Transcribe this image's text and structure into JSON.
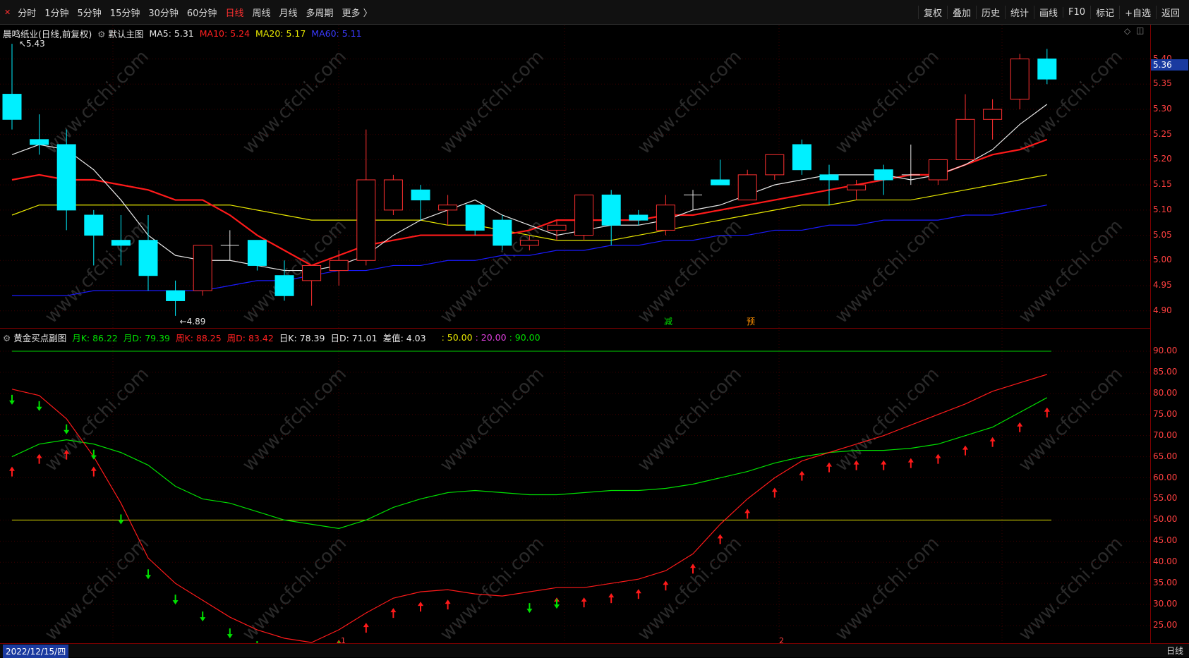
{
  "toolbar": {
    "left_items": [
      "分时",
      "1分钟",
      "5分钟",
      "15分钟",
      "30分钟",
      "60分钟",
      "日线",
      "周线",
      "月线",
      "多周期",
      "更多 〉"
    ],
    "active": "日线",
    "right_items": [
      "复权",
      "叠加",
      "历史",
      "统计",
      "画线",
      "F10",
      "标记",
      "+自选",
      "返回"
    ]
  },
  "main_info": {
    "stock": "晨鸣纸业(日线,前复权)",
    "indicator": "默认主图",
    "ma5": "MA5: 5.31",
    "ma10": "MA10: 5.24",
    "ma20": "MA20: 5.17",
    "ma60": "MA60: 5.11"
  },
  "sub_info": {
    "indicator": "黄金买点副图",
    "yk": "月K: 86.22",
    "yd": "月D: 79.39",
    "zk": "周K: 88.25",
    "zd": "周D: 83.42",
    "rk": "日K: 78.39",
    "rd": "日D: 71.01",
    "diff": "差值: 4.03",
    "l50": ": 50.00",
    "l20": ": 20.00",
    "l90": ": 90.00"
  },
  "main_axis": [
    "5.40",
    "5.35",
    "5.30",
    "5.25",
    "5.20",
    "5.15",
    "5.10",
    "5.05",
    "5.00",
    "4.95",
    "4.90"
  ],
  "sub_axis": [
    "90.00",
    "85.00",
    "80.00",
    "75.00",
    "70.00",
    "65.00",
    "60.00",
    "55.00",
    "50.00",
    "45.00",
    "40.00",
    "35.00",
    "30.00",
    "25.00"
  ],
  "current_price": "5.36",
  "high_label": "5.43",
  "low_label": "4.89",
  "markers": {
    "jian": "减",
    "yu": "预"
  },
  "bottom": {
    "date": "2022/12/15/四",
    "period": "日线",
    "m1": "1",
    "m2": "2"
  },
  "watermark": "www.cfchi.com",
  "colors": {
    "up": "#ff3030",
    "down": "#00f0ff",
    "ma5": "#e8e8e8",
    "ma10": "#ff1a1a",
    "ma20": "#e8e800",
    "ma60": "#1a1aff"
  },
  "chart_data": [
    {
      "type": "candlestick",
      "ylim": [
        4.88,
        5.44
      ],
      "candles": [
        [
          5.33,
          5.28,
          5.43,
          5.26
        ],
        [
          5.24,
          5.23,
          5.29,
          5.21
        ],
        [
          5.23,
          5.1,
          5.26,
          5.06
        ],
        [
          5.09,
          5.05,
          5.1,
          4.99
        ],
        [
          5.04,
          5.03,
          5.09,
          4.99
        ],
        [
          5.04,
          4.97,
          5.09,
          4.94
        ],
        [
          4.94,
          4.92,
          4.96,
          4.89
        ],
        [
          4.94,
          5.03,
          5.03,
          4.93
        ],
        [
          5.03,
          5.03,
          5.06,
          5.0
        ],
        [
          5.04,
          4.99,
          5.04,
          4.98
        ],
        [
          4.97,
          4.93,
          5.0,
          4.92
        ],
        [
          4.96,
          4.99,
          4.99,
          4.91
        ],
        [
          4.98,
          5.0,
          5.02,
          4.95
        ],
        [
          5.0,
          5.16,
          5.26,
          4.99
        ],
        [
          5.1,
          5.16,
          5.17,
          5.09
        ],
        [
          5.14,
          5.12,
          5.15,
          5.08
        ],
        [
          5.1,
          5.11,
          5.13,
          5.07
        ],
        [
          5.11,
          5.06,
          5.11,
          5.05
        ],
        [
          5.08,
          5.03,
          5.09,
          5.02
        ],
        [
          5.03,
          5.04,
          5.05,
          5.02
        ],
        [
          5.06,
          5.07,
          5.08,
          5.04
        ],
        [
          5.05,
          5.13,
          5.13,
          5.04
        ],
        [
          5.13,
          5.07,
          5.14,
          5.03
        ],
        [
          5.09,
          5.08,
          5.1,
          5.07
        ],
        [
          5.06,
          5.11,
          5.13,
          5.05
        ],
        [
          5.13,
          5.13,
          5.14,
          5.1
        ],
        [
          5.16,
          5.15,
          5.2,
          5.15
        ],
        [
          5.12,
          5.17,
          5.18,
          5.12
        ],
        [
          5.17,
          5.21,
          5.21,
          5.16
        ],
        [
          5.23,
          5.18,
          5.24,
          5.17
        ],
        [
          5.17,
          5.16,
          5.19,
          5.11
        ],
        [
          5.14,
          5.15,
          5.16,
          5.12
        ],
        [
          5.18,
          5.16,
          5.19,
          5.13
        ],
        [
          5.17,
          5.17,
          5.23,
          5.15
        ],
        [
          5.16,
          5.2,
          5.2,
          5.15
        ],
        [
          5.2,
          5.28,
          5.33,
          5.2
        ],
        [
          5.28,
          5.3,
          5.32,
          5.24
        ],
        [
          5.32,
          5.4,
          5.41,
          5.3
        ],
        [
          5.4,
          5.36,
          5.42,
          5.35
        ]
      ],
      "ma5": [
        5.21,
        5.23,
        5.22,
        5.18,
        5.12,
        5.05,
        5.01,
        5.0,
        5.0,
        4.99,
        4.98,
        4.98,
        4.99,
        5.01,
        5.05,
        5.08,
        5.1,
        5.12,
        5.09,
        5.07,
        5.05,
        5.06,
        5.07,
        5.07,
        5.08,
        5.1,
        5.11,
        5.13,
        5.15,
        5.16,
        5.17,
        5.17,
        5.17,
        5.16,
        5.17,
        5.19,
        5.22,
        5.27,
        5.31
      ],
      "ma10": [
        5.16,
        5.17,
        5.16,
        5.16,
        5.15,
        5.14,
        5.12,
        5.12,
        5.09,
        5.05,
        5.02,
        4.99,
        5.01,
        5.03,
        5.04,
        5.05,
        5.05,
        5.05,
        5.05,
        5.06,
        5.08,
        5.08,
        5.08,
        5.08,
        5.09,
        5.09,
        5.1,
        5.11,
        5.12,
        5.13,
        5.14,
        5.15,
        5.16,
        5.17,
        5.17,
        5.19,
        5.21,
        5.22,
        5.24
      ],
      "ma20": [
        5.09,
        5.11,
        5.11,
        5.11,
        5.11,
        5.11,
        5.11,
        5.11,
        5.11,
        5.1,
        5.09,
        5.08,
        5.08,
        5.08,
        5.08,
        5.08,
        5.07,
        5.07,
        5.06,
        5.05,
        5.04,
        5.04,
        5.04,
        5.05,
        5.06,
        5.07,
        5.08,
        5.09,
        5.1,
        5.11,
        5.11,
        5.12,
        5.12,
        5.12,
        5.13,
        5.14,
        5.15,
        5.16,
        5.17
      ],
      "ma60": [
        4.93,
        4.93,
        4.93,
        4.94,
        4.94,
        4.94,
        4.94,
        4.94,
        4.95,
        4.96,
        4.96,
        4.97,
        4.98,
        4.98,
        4.99,
        4.99,
        5.0,
        5.0,
        5.01,
        5.01,
        5.02,
        5.02,
        5.03,
        5.03,
        5.04,
        5.04,
        5.05,
        5.05,
        5.06,
        5.06,
        5.07,
        5.07,
        5.08,
        5.08,
        5.08,
        5.09,
        5.09,
        5.1,
        5.11
      ]
    },
    {
      "type": "line",
      "ylim": [
        22,
        93
      ],
      "levels": [
        90,
        50,
        20
      ],
      "series": [
        {
          "name": "月K",
          "values": [
            65,
            68,
            69,
            68,
            66,
            63,
            58,
            55,
            54,
            52,
            50,
            49,
            48,
            50,
            53,
            55,
            56.5,
            57,
            56.5,
            56,
            56,
            56.5,
            57,
            57,
            57.5,
            58.5,
            60,
            61.5,
            63.5,
            65,
            66,
            66.5,
            66.5,
            67,
            68,
            70,
            72,
            75.5,
            79
          ]
        },
        {
          "name": "月D",
          "values": [
            81,
            79.5,
            74,
            65,
            54,
            41,
            35,
            31,
            27,
            24,
            22,
            21,
            24,
            28,
            31.5,
            33,
            33.5,
            32.5,
            32,
            33,
            34,
            34,
            35,
            36,
            38,
            42,
            49,
            55,
            60,
            64,
            66,
            68,
            70,
            72.5,
            75,
            77.5,
            80.5,
            82.5,
            84.5
          ]
        }
      ],
      "arrows_up": [
        0,
        1,
        2,
        3,
        12,
        13,
        14,
        15,
        16,
        20,
        21,
        22,
        23,
        24,
        25,
        26,
        27,
        28,
        29,
        30,
        31,
        32,
        33,
        34,
        35,
        36,
        37,
        38
      ],
      "arrows_down": [
        0,
        1,
        2,
        3,
        4,
        5,
        6,
        7,
        8,
        9,
        10,
        11,
        12,
        19,
        20
      ]
    }
  ]
}
